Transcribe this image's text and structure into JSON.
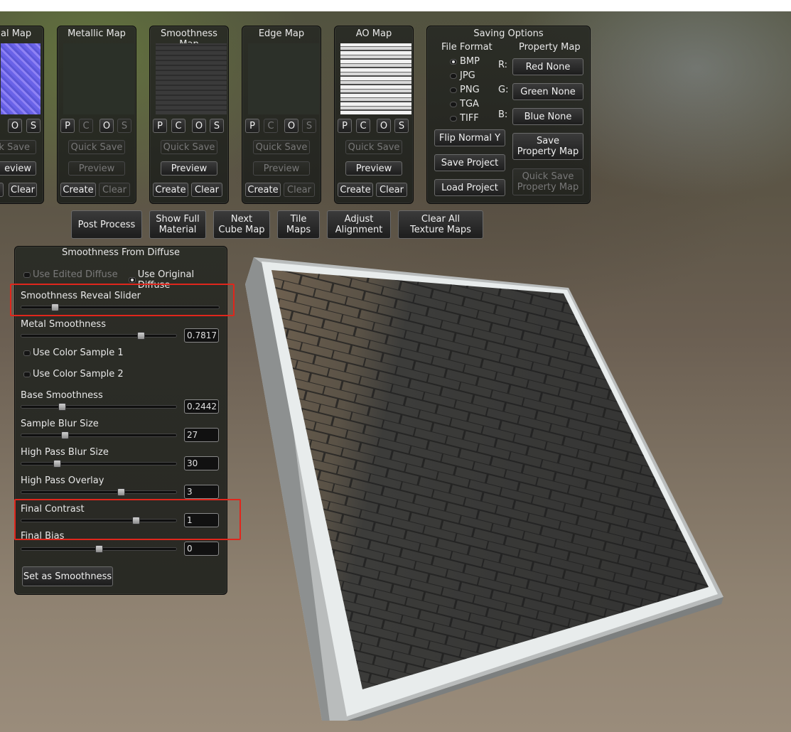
{
  "map_panels": [
    {
      "title": "al Map",
      "buttons": [
        "O",
        "S"
      ],
      "quick_save": "k Save",
      "preview": "eview",
      "create": "",
      "clear": "Clear"
    },
    {
      "title": "Metallic Map",
      "buttons": [
        "P",
        "C",
        "O",
        "S"
      ],
      "quick_save": "Quick Save",
      "preview": "Preview",
      "create": "Create",
      "clear": "Clear"
    },
    {
      "title": "Smoothness Map",
      "buttons": [
        "P",
        "C",
        "O",
        "S"
      ],
      "quick_save": "Quick Save",
      "preview": "Preview",
      "create": "Create",
      "clear": "Clear"
    },
    {
      "title": "Edge Map",
      "buttons": [
        "P",
        "C",
        "O",
        "S"
      ],
      "quick_save": "Quick Save",
      "preview": "Preview",
      "create": "Create",
      "clear": "Clear"
    },
    {
      "title": "AO Map",
      "buttons": [
        "P",
        "C",
        "O",
        "S"
      ],
      "quick_save": "Quick Save",
      "preview": "Preview",
      "create": "Create",
      "clear": "Clear"
    }
  ],
  "saving": {
    "title": "Saving Options",
    "file_format_label": "File Format",
    "property_map_label": "Property Map",
    "formats": [
      "BMP",
      "JPG",
      "PNG",
      "TGA",
      "TIFF"
    ],
    "selected_format": "BMP",
    "channels": [
      {
        "label": "R:",
        "button": "Red None"
      },
      {
        "label": "G:",
        "button": "Green None"
      },
      {
        "label": "B:",
        "button": "Blue None"
      }
    ],
    "flip_normal": "Flip Normal Y",
    "save_project": "Save Project",
    "load_project": "Load Project",
    "save_property_map": "Save\nProperty Map",
    "quick_save_property_map": "Quick Save\nProperty Map"
  },
  "toolbar": {
    "post_process": "Post Process",
    "show_full_material": "Show Full\nMaterial",
    "next_cube_map": "Next\nCube Map",
    "tile_maps": "Tile\nMaps",
    "adjust_alignment": "Adjust\nAlignment",
    "clear_all": "Clear All\nTexture Maps"
  },
  "smoothness_panel": {
    "title": "Smoothness From Diffuse",
    "use_edited_diffuse": "Use Edited Diffuse",
    "use_original_diffuse": "Use Original Diffuse",
    "reveal_slider_label": "Smoothness Reveal Slider",
    "reveal_slider_value": 0.17,
    "sliders": [
      {
        "label": "Metal Smoothness",
        "value": "0.7817",
        "fraction": 0.77
      },
      {
        "label": "Base Smoothness",
        "value": "0.2442",
        "fraction": 0.26
      },
      {
        "label": "Sample Blur Size",
        "value": "27",
        "fraction": 0.28
      },
      {
        "label": "High Pass Blur Size",
        "value": "30",
        "fraction": 0.23
      },
      {
        "label": "High Pass Overlay",
        "value": "3",
        "fraction": 0.64
      },
      {
        "label": "Final Contrast",
        "value": "1",
        "fraction": 0.74
      },
      {
        "label": "Final Bias",
        "value": "0",
        "fraction": 0.5
      }
    ],
    "color_sample_1": "Use Color Sample 1",
    "color_sample_2": "Use Color Sample 2",
    "set_button": "Set as Smoothness"
  }
}
